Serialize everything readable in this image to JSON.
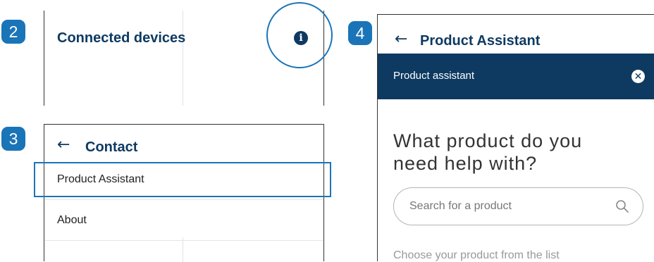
{
  "steps": {
    "step2": "2",
    "step3": "3",
    "step4": "4"
  },
  "panel2": {
    "title": "Connected devices",
    "icon": "info-icon"
  },
  "panel3": {
    "back_icon": "back-arrow-icon",
    "title": "Contact",
    "items": [
      {
        "label": "Product Assistant",
        "highlighted": true
      },
      {
        "label": "About"
      }
    ]
  },
  "panel4": {
    "back_icon": "back-arrow-icon",
    "title": "Product Assistant",
    "banner": {
      "label": "Product assistant",
      "close_icon": "close-icon"
    },
    "question": "What product do you need help with?",
    "search": {
      "placeholder": "Search for a product",
      "value": "",
      "icon": "search-icon"
    },
    "choose_text": "Choose your product from the list"
  },
  "colors": {
    "accent": "#1a74b8",
    "brand_navy": "#0e3a62"
  }
}
